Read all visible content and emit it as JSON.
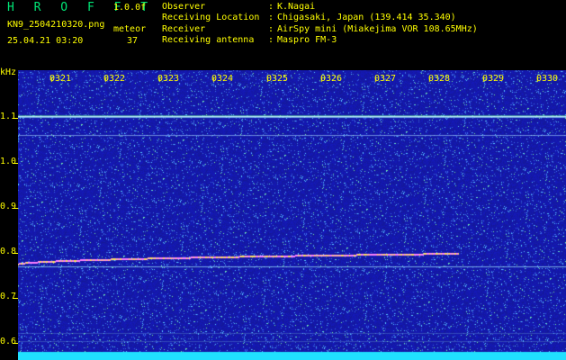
{
  "header": {
    "title": "H R O F F T",
    "version": "1.0.0f",
    "filename": "KN9_2504210320.png",
    "mode_label": "meteor",
    "datetime": "25.04.21 03:20",
    "count": "37"
  },
  "info": [
    {
      "key": "Observer",
      "value": "K.Nagai"
    },
    {
      "key": "Receiving Location",
      "value": "Chigasaki, Japan (139.414 35.340)"
    },
    {
      "key": "Receiver",
      "value": "AirSpy mini (Miakejima VOR 108.65MHz)"
    },
    {
      "key": "Receiving antenna",
      "value": "Maspro FM-3"
    }
  ],
  "axis": {
    "unit": "kHz",
    "y_ticks": [
      "1.1",
      "1.0",
      "0.9",
      "0.8",
      "0.7",
      "0.6"
    ],
    "x_ticks": [
      "0321",
      "0322",
      "0323",
      "0324",
      "0325",
      "0326",
      "0327",
      "0328",
      "0329",
      "0330"
    ]
  },
  "colors": {
    "background": "#000000",
    "label": "#ffff00",
    "title": "#00e676",
    "noise_base": "#1a1aa8"
  }
}
